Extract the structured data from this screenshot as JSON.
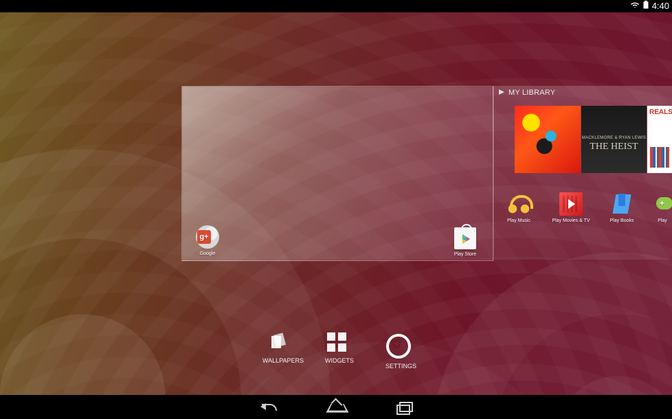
{
  "status_bar": {
    "time": "4:40"
  },
  "preview": {
    "library_title": "MY LIBRARY"
  },
  "shortcuts": {
    "google": "Google",
    "play_store": "Play Store"
  },
  "library": {
    "album_text_1": "MACKLEMORE & RYAN LEWIS",
    "album_text_2": "THE HEIST",
    "apps": [
      {
        "label": "Play Music"
      },
      {
        "label": "Play Movies & TV"
      },
      {
        "label": "Play Books"
      },
      {
        "label": "Play"
      }
    ]
  },
  "overview": {
    "wallpapers": "WALLPAPERS",
    "widgets": "WIDGETS",
    "settings": "SETTINGS"
  },
  "icons": {
    "wifi": "wifi-icon",
    "battery": "battery-icon",
    "back": "back-icon",
    "home": "home-icon",
    "recent": "recent-apps-icon"
  }
}
